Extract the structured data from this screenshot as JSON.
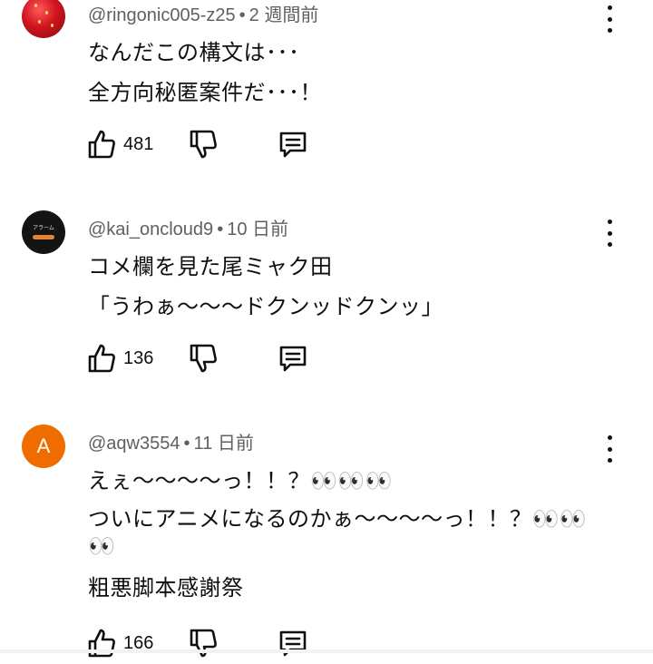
{
  "comments": [
    {
      "author": "@ringonic005-z25",
      "time": "2 週間前",
      "lines": [
        "なんだこの構文は･･･",
        "全方向秘匿案件だ･･･！"
      ],
      "likes": "481",
      "avatar": "strawberry-photo"
    },
    {
      "author": "@kai_oncloud9",
      "time": "10 日前",
      "lines": [
        "コメ欄を見た尾ミャク田",
        "「うわぁ〜〜〜ドクンッドクンッ」"
      ],
      "likes": "136",
      "avatar": "alarm-app-icon",
      "avatar_text": "アラーム"
    },
    {
      "author": "@aqw3554",
      "time": "11 日前",
      "lines": [
        "えぇ〜〜〜〜っ！！？👀👀👀",
        "ついにアニメになるのかぁ〜〜〜〜っ！！？👀👀",
        "👀",
        "粗悪脚本感謝祭"
      ],
      "likes": "166",
      "avatar": "letter-avatar",
      "avatar_letter": "A"
    }
  ],
  "colors": {
    "text": "#0f0f0f",
    "meta": "#606060",
    "letter_avatar_bg": "#ef6c00"
  },
  "icons": [
    "like-icon",
    "dislike-icon",
    "reply-icon",
    "more-options-icon"
  ]
}
